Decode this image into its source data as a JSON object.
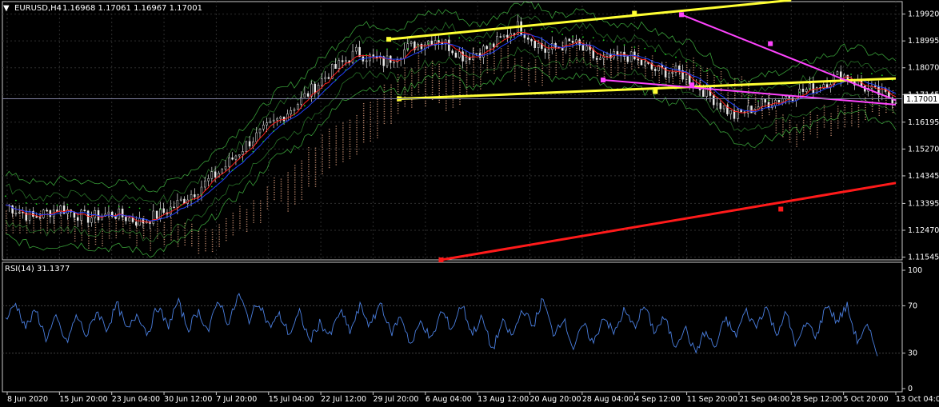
{
  "header": {
    "symbol": "EURUSD,H4",
    "ohlc": "1.16968 1.17061 1.16967 1.17001"
  },
  "rsi_header": "RSI(14) 31.1377",
  "colors": {
    "background": "#000000",
    "grid": "#2e2e2e",
    "frame": "#c8c8c8",
    "candle": "#e8e8e8",
    "ma_red": "#ff2020",
    "ma_blue": "#2040ff",
    "ma_green": "#20d020",
    "cloud": "#e0a080",
    "envelope": "#50e050",
    "yellow": "#ffff33",
    "magenta": "#ff44ff",
    "trend_red": "#ff1a1a",
    "rsi_line": "#4a7fe0",
    "price_box": "#ffffff"
  },
  "chart_data": [
    {
      "type": "line",
      "title": "EURUSD,H4",
      "price_axis": {
        "ticks": [
          "1.19920",
          "1.18995",
          "1.18070",
          "1.17145",
          "1.16195",
          "1.15270",
          "1.14345",
          "1.13395",
          "1.12470",
          "1.11545"
        ],
        "tick_values": [
          1.1992,
          1.18995,
          1.1807,
          1.17145,
          1.16195,
          1.1527,
          1.14345,
          1.13395,
          1.1247,
          1.11545
        ],
        "ylim": [
          1.1145,
          1.2035
        ],
        "current_price": "1.17001",
        "current_value": 1.17001
      },
      "time_axis": {
        "ticks": [
          "8 Jun 2020",
          "15 Jun 20:00",
          "23 Jun 04:00",
          "30 Jun 12:00",
          "7 Jul 20:00",
          "15 Jul 04:00",
          "22 Jul 12:00",
          "29 Jul 20:00",
          "6 Aug 04:00",
          "13 Aug 12:00",
          "20 Aug 20:00",
          "28 Aug 04:00",
          "4 Sep 12:00",
          "11 Sep 20:00",
          "21 Sep 04:00",
          "28 Sep 12:00",
          "5 Oct 20:00",
          "13 Oct 04:00"
        ],
        "count": 18
      },
      "price_path": [
        [
          0,
          1.1335
        ],
        [
          1,
          1.129
        ],
        [
          2,
          1.1325
        ],
        [
          3,
          1.129
        ],
        [
          4,
          1.1305
        ],
        [
          5,
          1.1275
        ],
        [
          6,
          1.1315
        ],
        [
          7,
          1.138
        ],
        [
          8,
          1.1455
        ],
        [
          9,
          1.155
        ],
        [
          10,
          1.162
        ],
        [
          11,
          1.17
        ],
        [
          12,
          1.179
        ],
        [
          13,
          1.186
        ],
        [
          14,
          1.1825
        ],
        [
          15,
          1.188
        ],
        [
          16,
          1.191
        ],
        [
          17,
          1.1845
        ],
        [
          18,
          1.188
        ],
        [
          19,
          1.195
        ],
        [
          20,
          1.1865
        ],
        [
          21,
          1.1895
        ],
        [
          22,
          1.183
        ],
        [
          23,
          1.185
        ],
        [
          24,
          1.18
        ],
        [
          25,
          1.179
        ],
        [
          26,
          1.172
        ],
        [
          27,
          1.164
        ],
        [
          28,
          1.168
        ],
        [
          29,
          1.171
        ],
        [
          30,
          1.174
        ],
        [
          31,
          1.1785
        ],
        [
          32,
          1.173
        ],
        [
          33,
          1.17
        ]
      ],
      "trendlines": [
        {
          "name": "yellow-upper",
          "color": "yellow",
          "p1": [
            7.3,
            1.1905
          ],
          "p2": [
            12.0,
            1.1995
          ],
          "ext": [
            15.0,
            1.204
          ]
        },
        {
          "name": "yellow-lower",
          "color": "yellow",
          "p1": [
            7.5,
            1.17
          ],
          "p2": [
            12.4,
            1.1725
          ],
          "ext": [
            18.0,
            1.177
          ]
        },
        {
          "name": "magenta-upper",
          "color": "magenta",
          "p1": [
            12.9,
            1.199
          ],
          "p2": [
            14.6,
            1.189
          ],
          "ext": [
            18.0,
            1.1695
          ]
        },
        {
          "name": "magenta-lower",
          "color": "magenta",
          "p1": [
            11.4,
            1.1765
          ],
          "p2": [
            13.1,
            1.1748
          ],
          "ext": [
            18.0,
            1.168
          ]
        },
        {
          "name": "red-support",
          "color": "trend_red",
          "p1": [
            8.3,
            1.1145
          ],
          "p2": [
            14.8,
            1.132
          ],
          "ext": [
            18.0,
            1.141
          ]
        }
      ]
    },
    {
      "type": "line",
      "title": "RSI(14) 31.1377",
      "ticks": [
        "100",
        "70",
        "30",
        "0"
      ],
      "tick_values": [
        100,
        70,
        30,
        0
      ],
      "ylim": [
        0,
        100
      ],
      "last_value": 31.1377,
      "series": [
        {
          "values": [
            58,
            72,
            52,
            66,
            42,
            60,
            38,
            62,
            44,
            66,
            50,
            72,
            48,
            64,
            46,
            70,
            52,
            74,
            50,
            66,
            48,
            76,
            54,
            80,
            58,
            74,
            52,
            62,
            46,
            64,
            40,
            56,
            44,
            66,
            48,
            70,
            52,
            74,
            46,
            62,
            36,
            58,
            40,
            66,
            50,
            72,
            46,
            60,
            32,
            56,
            44,
            68,
            52,
            76,
            46,
            60,
            34,
            54,
            38,
            62,
            46,
            66,
            52,
            70,
            48,
            60,
            36,
            52,
            30,
            48,
            34,
            60,
            44,
            66,
            52,
            70,
            46,
            64,
            36,
            56,
            44,
            72,
            56,
            70,
            40,
            52,
            31
          ]
        }
      ]
    }
  ]
}
